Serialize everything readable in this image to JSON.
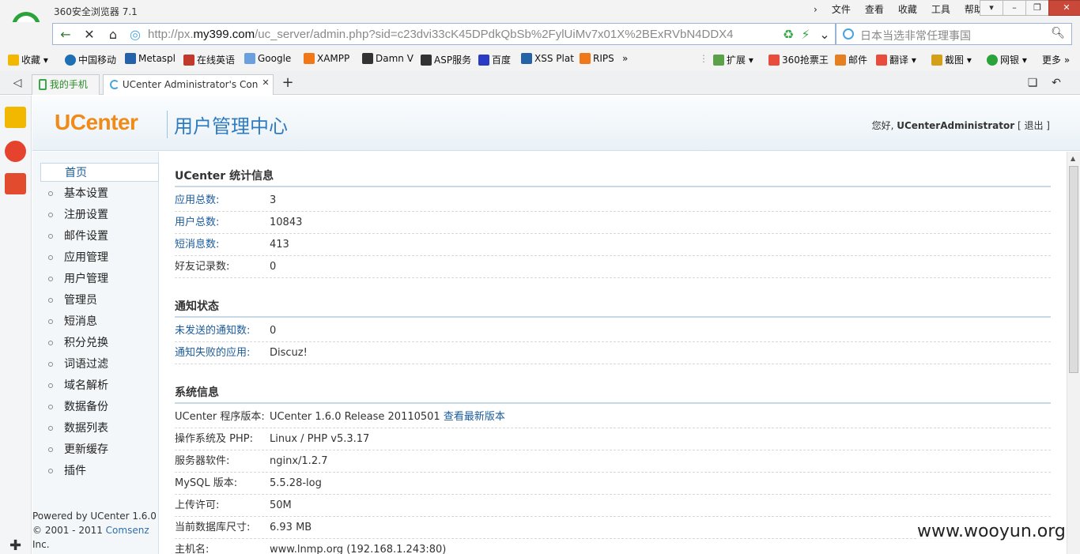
{
  "browser": {
    "app_title": "360安全浏览器 7.1",
    "menu": [
      "文件",
      "查看",
      "收藏",
      "工具",
      "帮助"
    ],
    "url_prefix": "http://px.",
    "url_domain": "my399.com",
    "url_path": "/uc_server/admin.php?sid=c23dvi33cK45DPdkQbSb%2FylUiMv7x01X%2BExRVbN4DDX4",
    "search_placeholder": "日本当选非常任理事国",
    "bookmarks": [
      "收藏",
      "中国移动",
      "Metaspl",
      "在线英语",
      "Google",
      "XAMPP",
      "Damn V",
      "ASP服务",
      "百度",
      "XSS Plat",
      "RIPS"
    ],
    "bookmarks_right": [
      "扩展",
      "360抢票王",
      "邮件",
      "翻译",
      "截图",
      "网银",
      "更多"
    ],
    "tabs": [
      {
        "label": "我的手机"
      },
      {
        "label": "UCenter Administrator's Con"
      }
    ]
  },
  "header": {
    "logo": "UCenter",
    "subtitle": "用户管理中心",
    "greeting_prefix": "您好, ",
    "username": "UCenterAdministrator",
    "logout": "[ 退出 ]"
  },
  "sidebar": {
    "items": [
      "首页",
      "基本设置",
      "注册设置",
      "邮件设置",
      "应用管理",
      "用户管理",
      "管理员",
      "短消息",
      "积分兑换",
      "词语过滤",
      "域名解析",
      "数据备份",
      "数据列表",
      "更新缓存",
      "插件"
    ],
    "powered_line1": "Powered by UCenter 1.6.0",
    "powered_line2_prefix": "© 2001 - 2011 ",
    "powered_link": "Comsenz",
    "powered_line3": "Inc."
  },
  "sections": {
    "stats": {
      "title": "UCenter 统计信息",
      "rows": [
        {
          "k": "应用总数:",
          "v": "3"
        },
        {
          "k": "用户总数:",
          "v": "10843"
        },
        {
          "k": "短消息数:",
          "v": "413"
        },
        {
          "k": "好友记录数:",
          "v": "0"
        }
      ]
    },
    "notice": {
      "title": "通知状态",
      "rows": [
        {
          "k": "未发送的通知数:",
          "v": "0"
        },
        {
          "k": "通知失败的应用:",
          "v": "Discuz!"
        }
      ]
    },
    "system": {
      "title": "系统信息",
      "rows": [
        {
          "k": "UCenter 程序版本:",
          "v": "UCenter 1.6.0 Release 20110501",
          "link": "查看最新版本"
        },
        {
          "k": "操作系统及 PHP:",
          "v": "Linux / PHP v5.3.17"
        },
        {
          "k": "服务器软件:",
          "v": "nginx/1.2.7"
        },
        {
          "k": "MySQL 版本:",
          "v": "5.5.28-log"
        },
        {
          "k": "上传许可:",
          "v": "50M"
        },
        {
          "k": "当前数据库尺寸:",
          "v": "6.93 MB"
        },
        {
          "k": "主机名:",
          "v": "www.lnmp.org (192.168.1.243:80)"
        }
      ]
    }
  },
  "watermark": "www.wooyun.org"
}
